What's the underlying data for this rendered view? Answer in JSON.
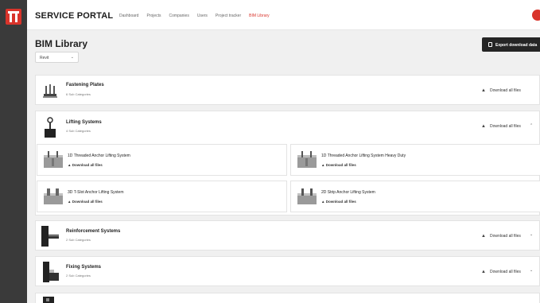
{
  "app": {
    "brand": "SERVICE PORTAL"
  },
  "nav": [
    {
      "label": "Dashboard",
      "active": false
    },
    {
      "label": "Projects",
      "active": false
    },
    {
      "label": "Companies",
      "active": false
    },
    {
      "label": "Users",
      "active": false
    },
    {
      "label": "Project tracker",
      "active": false
    },
    {
      "label": "BIM Library",
      "active": true
    }
  ],
  "page": {
    "title": "BIM Library",
    "select_value": "Revit",
    "export_label": "Export download data"
  },
  "download_label": "Download all files",
  "categories": [
    {
      "name": "Fastening Plates",
      "sub": "6 Sub Categories",
      "expanded": false,
      "icon": "fastening-plate-icon"
    },
    {
      "name": "Lifting Systems",
      "sub": "4 Sub Categories",
      "expanded": true,
      "icon": "lifting-system-icon",
      "subcategories": [
        {
          "name": "1D Threaded Anchor Lifting System",
          "download": "Download all files"
        },
        {
          "name": "1D Threaded Anchor Lifting System Heavy Duty",
          "download": "Download all files"
        },
        {
          "name": "3D T-Slot Anchor Lifting System",
          "download": "Download all files"
        },
        {
          "name": "2D Strip Anchor Lifting System",
          "download": "Download all files"
        }
      ]
    },
    {
      "name": "Reinforcement Systems",
      "sub": "2 Sub Categories",
      "expanded": false,
      "icon": "reinforcement-system-icon"
    },
    {
      "name": "Fixing Systems",
      "sub": "2 Sub Categories",
      "expanded": false,
      "icon": "fixing-system-icon"
    }
  ],
  "colors": {
    "accent": "#d9342b",
    "rail": "#3a3a3a",
    "button": "#252525"
  }
}
